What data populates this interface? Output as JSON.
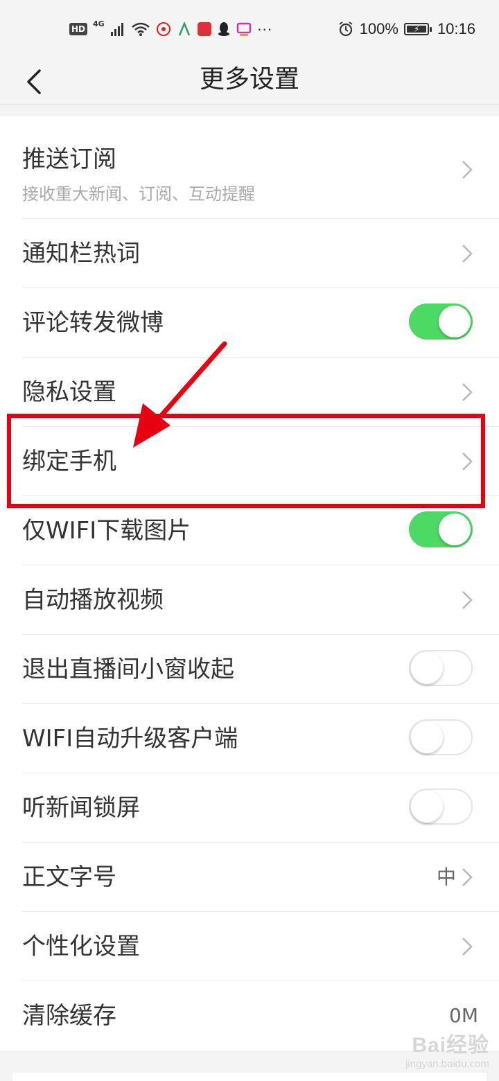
{
  "status_bar": {
    "network_badge": "HD",
    "signal_label": "4G",
    "battery_percent": "100%",
    "time": "10:16",
    "more_indicator": "···",
    "notification_icons": [
      "sina-weibo-icon",
      "app-icon",
      "reader-icon",
      "qq-icon",
      "tv-icon"
    ]
  },
  "header": {
    "title": "更多设置"
  },
  "settings": {
    "push": {
      "label": "推送订阅",
      "sublabel": "接收重大新闻、订阅、互动提醒"
    },
    "hotwords": {
      "label": "通知栏热词"
    },
    "comment": {
      "label": "评论转发微博",
      "toggle": true
    },
    "privacy": {
      "label": "隐私设置"
    },
    "bind_phone": {
      "label": "绑定手机"
    },
    "wifi_img": {
      "label": "仅WIFI下载图片",
      "toggle": true
    },
    "autoplay": {
      "label": "自动播放视频"
    },
    "live_window": {
      "label": "退出直播间小窗收起",
      "toggle": false
    },
    "wifi_upgrade": {
      "label": "WIFI自动升级客户端",
      "toggle": false
    },
    "lockscreen": {
      "label": "听新闻锁屏",
      "toggle": false
    },
    "font_size": {
      "label": "正文字号",
      "value": "中"
    },
    "personal": {
      "label": "个性化设置"
    },
    "cache": {
      "label": "清除缓存",
      "value": "0M"
    }
  },
  "colors": {
    "toggle_on": "#4cd964",
    "annotation": "#e60012"
  },
  "watermark": {
    "main": "Bai经验",
    "sub": "jingyan.baidu.com"
  }
}
